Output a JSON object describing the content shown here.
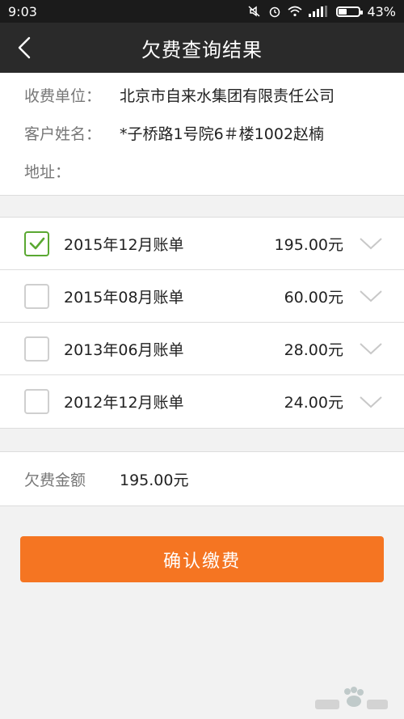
{
  "status": {
    "time": "9:03",
    "battery_text": "43%",
    "battery_level": 0.43,
    "icons": [
      "mute-icon",
      "alarm-icon",
      "wifi-icon",
      "signal-icon",
      "battery-icon"
    ]
  },
  "header": {
    "title": "欠费查询结果",
    "back_icon": "chevron-left-icon"
  },
  "info": {
    "unit_label": "收费单位：",
    "unit_value": "北京市自来水集团有限责任公司",
    "name_label": "客户姓名：",
    "name_value": "*子桥路1号院6＃楼1002赵楠",
    "address_label": "地址："
  },
  "bills": [
    {
      "name": "2015年12月账单",
      "amount": "195.00元",
      "checked": true
    },
    {
      "name": "2015年08月账单",
      "amount": "60.00元",
      "checked": false
    },
    {
      "name": "2013年06月账单",
      "amount": "28.00元",
      "checked": false
    },
    {
      "name": "2012年12月账单",
      "amount": "24.00元",
      "checked": false
    }
  ],
  "total": {
    "label": "欠费金额",
    "value": "195.00元"
  },
  "confirm_label": "确认缴费",
  "colors": {
    "accent": "#f57522",
    "check": "#5aa832",
    "header_bg": "#2a2a2a"
  }
}
